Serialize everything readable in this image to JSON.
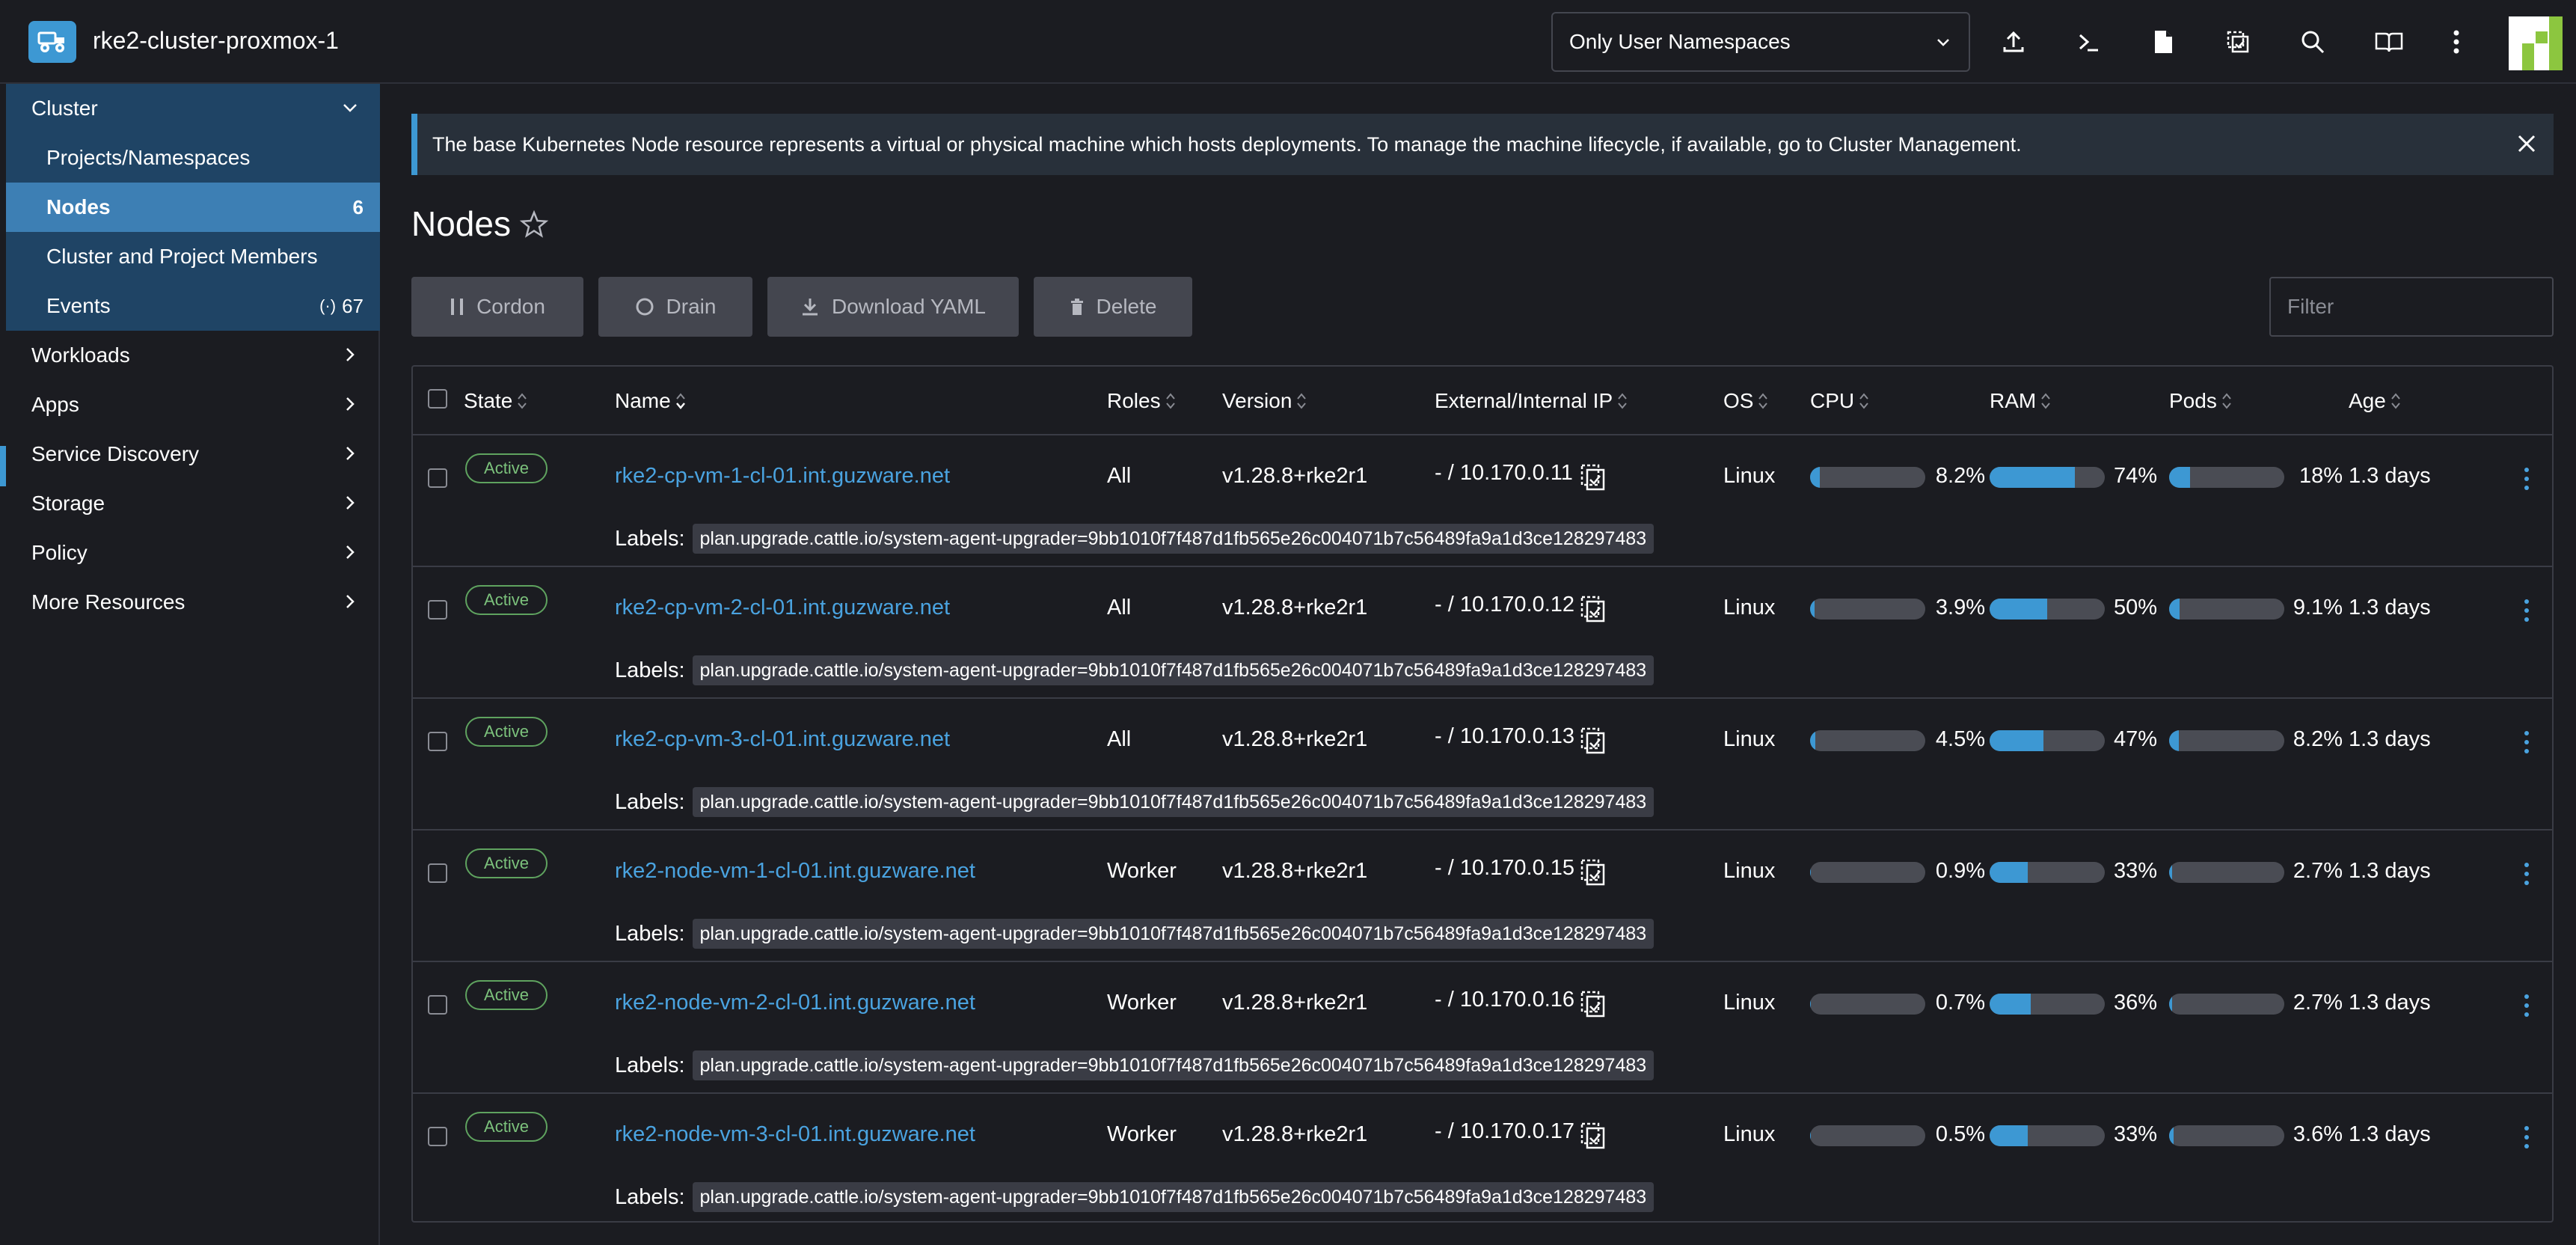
{
  "app": {
    "cluster_name": "rke2-cluster-proxmox-1",
    "namespace_filter": "Only User Namespaces",
    "header_icons": [
      "upload-icon",
      "terminal-icon",
      "file-icon",
      "copy-config-icon",
      "search-icon",
      "book-icon",
      "more-vertical-icon"
    ]
  },
  "sidebar": {
    "group_label": "Cluster",
    "sub_items": [
      {
        "label": "Projects/Namespaces"
      },
      {
        "label": "Nodes",
        "count": "6"
      },
      {
        "label": "Cluster and Project Members"
      },
      {
        "label": "Events",
        "count": "67"
      }
    ],
    "top_items": [
      {
        "label": "Workloads"
      },
      {
        "label": "Apps"
      },
      {
        "label": "Service Discovery"
      },
      {
        "label": "Storage"
      },
      {
        "label": "Policy"
      },
      {
        "label": "More Resources"
      }
    ]
  },
  "banner": {
    "text": "The base Kubernetes Node resource represents a virtual or physical machine which hosts deployments. To manage the machine lifecycle, if available, go to Cluster Management."
  },
  "page": {
    "title": "Nodes"
  },
  "toolbar": {
    "cordon": "Cordon",
    "drain": "Drain",
    "download_yaml": "Download YAML",
    "delete": "Delete",
    "filter_placeholder": "Filter"
  },
  "table": {
    "headers": {
      "state": "State",
      "name": "Name",
      "roles": "Roles",
      "version": "Version",
      "ip": "External/Internal IP",
      "os": "OS",
      "cpu": "CPU",
      "ram": "RAM",
      "pods": "Pods",
      "age": "Age"
    },
    "labels_prefix": "Labels:",
    "rows": [
      {
        "state": "Active",
        "name": "rke2-cp-vm-1-cl-01.int.guzware.net",
        "roles": "All",
        "version": "v1.28.8+rke2r1",
        "ip": "- / 10.170.0.11",
        "os": "Linux",
        "cpu": "8.2%",
        "cpu_value": 8.2,
        "ram": "74%",
        "ram_value": 74,
        "pods": "18%",
        "pods_value": 18,
        "age": "1.3 days",
        "label": "plan.upgrade.cattle.io/system-agent-upgrader=9bb1010f7f487d1fb565e26c004071b7c56489fa9a1d3ce128297483"
      },
      {
        "state": "Active",
        "name": "rke2-cp-vm-2-cl-01.int.guzware.net",
        "roles": "All",
        "version": "v1.28.8+rke2r1",
        "ip": "- / 10.170.0.12",
        "os": "Linux",
        "cpu": "3.9%",
        "cpu_value": 3.9,
        "ram": "50%",
        "ram_value": 50,
        "pods": "9.1%",
        "pods_value": 9.1,
        "age": "1.3 days",
        "label": "plan.upgrade.cattle.io/system-agent-upgrader=9bb1010f7f487d1fb565e26c004071b7c56489fa9a1d3ce128297483"
      },
      {
        "state": "Active",
        "name": "rke2-cp-vm-3-cl-01.int.guzware.net",
        "roles": "All",
        "version": "v1.28.8+rke2r1",
        "ip": "- / 10.170.0.13",
        "os": "Linux",
        "cpu": "4.5%",
        "cpu_value": 4.5,
        "ram": "47%",
        "ram_value": 47,
        "pods": "8.2%",
        "pods_value": 8.2,
        "age": "1.3 days",
        "label": "plan.upgrade.cattle.io/system-agent-upgrader=9bb1010f7f487d1fb565e26c004071b7c56489fa9a1d3ce128297483"
      },
      {
        "state": "Active",
        "name": "rke2-node-vm-1-cl-01.int.guzware.net",
        "roles": "Worker",
        "version": "v1.28.8+rke2r1",
        "ip": "- / 10.170.0.15",
        "os": "Linux",
        "cpu": "0.9%",
        "cpu_value": 0.9,
        "ram": "33%",
        "ram_value": 33,
        "pods": "2.7%",
        "pods_value": 2.7,
        "age": "1.3 days",
        "label": "plan.upgrade.cattle.io/system-agent-upgrader=9bb1010f7f487d1fb565e26c004071b7c56489fa9a1d3ce128297483"
      },
      {
        "state": "Active",
        "name": "rke2-node-vm-2-cl-01.int.guzware.net",
        "roles": "Worker",
        "version": "v1.28.8+rke2r1",
        "ip": "- / 10.170.0.16",
        "os": "Linux",
        "cpu": "0.7%",
        "cpu_value": 0.7,
        "ram": "36%",
        "ram_value": 36,
        "pods": "2.7%",
        "pods_value": 2.7,
        "age": "1.3 days",
        "label": "plan.upgrade.cattle.io/system-agent-upgrader=9bb1010f7f487d1fb565e26c004071b7c56489fa9a1d3ce128297483"
      },
      {
        "state": "Active",
        "name": "rke2-node-vm-3-cl-01.int.guzware.net",
        "roles": "Worker",
        "version": "v1.28.8+rke2r1",
        "ip": "- / 10.170.0.17",
        "os": "Linux",
        "cpu": "0.5%",
        "cpu_value": 0.5,
        "ram": "33%",
        "ram_value": 33,
        "pods": "3.6%",
        "pods_value": 3.6,
        "age": "1.3 days",
        "label": "plan.upgrade.cattle.io/system-agent-upgrader=9bb1010f7f487d1fb565e26c004071b7c56489fa9a1d3ce128297483"
      }
    ]
  },
  "colors": {
    "accent": "#3d98d3",
    "sidebar_group_bg": "#1f4465",
    "active_item_bg": "#3d7fb4",
    "active_badge": "#5fa35f"
  }
}
